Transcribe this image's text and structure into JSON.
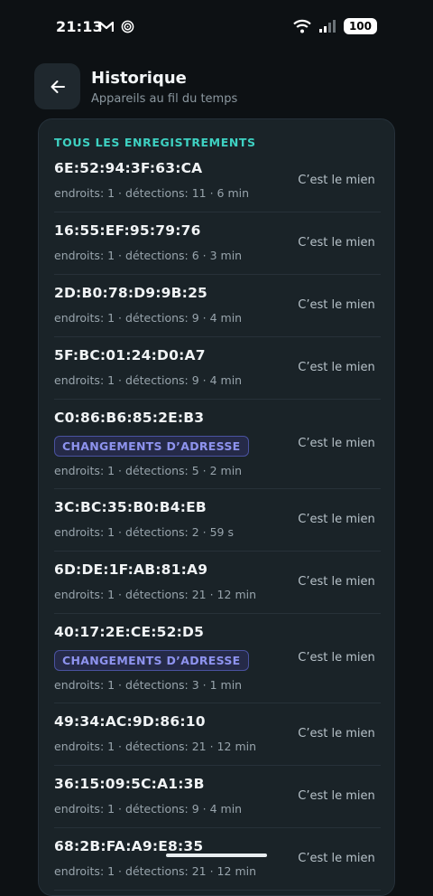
{
  "status_bar": {
    "time": "21:13",
    "battery": "100",
    "left_icons": [
      "gmail-icon",
      "sync-icon"
    ],
    "right_icons": [
      "wifi-icon",
      "signal-icon"
    ]
  },
  "header": {
    "title": "Historique",
    "subtitle": "Appareils au fil du temps",
    "back_icon": "arrow-left-icon"
  },
  "section_label": "TOUS LES ENREGISTREMENTS",
  "records": [
    {
      "address": "6E:52:94:3F:63:CA",
      "meta": "endroits: 1 · détections: 11 · 6 min",
      "badge": "",
      "action": "C’est le mien"
    },
    {
      "address": "16:55:EF:95:79:76",
      "meta": "endroits: 1 · détections: 6 · 3 min",
      "badge": "",
      "action": "C’est le mien"
    },
    {
      "address": "2D:B0:78:D9:9B:25",
      "meta": "endroits: 1 · détections: 9 · 4 min",
      "badge": "",
      "action": "C’est le mien"
    },
    {
      "address": "5F:BC:01:24:D0:A7",
      "meta": "endroits: 1 · détections: 9 · 4 min",
      "badge": "",
      "action": "C’est le mien"
    },
    {
      "address": "C0:86:B6:85:2E:B3",
      "meta": "endroits: 1 · détections: 5 · 2 min",
      "badge": "CHANGEMENTS D’ADRESSE",
      "action": "C’est le mien"
    },
    {
      "address": "3C:BC:35:B0:B4:EB",
      "meta": "endroits: 1 · détections: 2 · 59 s",
      "badge": "",
      "action": "C’est le mien"
    },
    {
      "address": "6D:DE:1F:AB:81:A9",
      "meta": "endroits: 1 · détections: 21 · 12 min",
      "badge": "",
      "action": "C’est le mien"
    },
    {
      "address": "40:17:2E:CE:52:D5",
      "meta": "endroits: 1 · détections: 3 · 1 min",
      "badge": "CHANGEMENTS D’ADRESSE",
      "action": "C’est le mien"
    },
    {
      "address": "49:34:AC:9D:86:10",
      "meta": "endroits: 1 · détections: 21 · 12 min",
      "badge": "",
      "action": "C’est le mien"
    },
    {
      "address": "36:15:09:5C:A1:3B",
      "meta": "endroits: 1 · détections: 9 · 4 min",
      "badge": "",
      "action": "C’est le mien"
    },
    {
      "address": "68:2B:FA:A9:E8:35",
      "meta": "endroits: 1 · détections: 21 · 12 min",
      "badge": "",
      "action": "C’est le mien"
    }
  ],
  "colors": {
    "background": "#0d1114",
    "card": "#1a2328",
    "accent_teal": "#3ed1c2",
    "badge_text": "#8e93ee"
  }
}
